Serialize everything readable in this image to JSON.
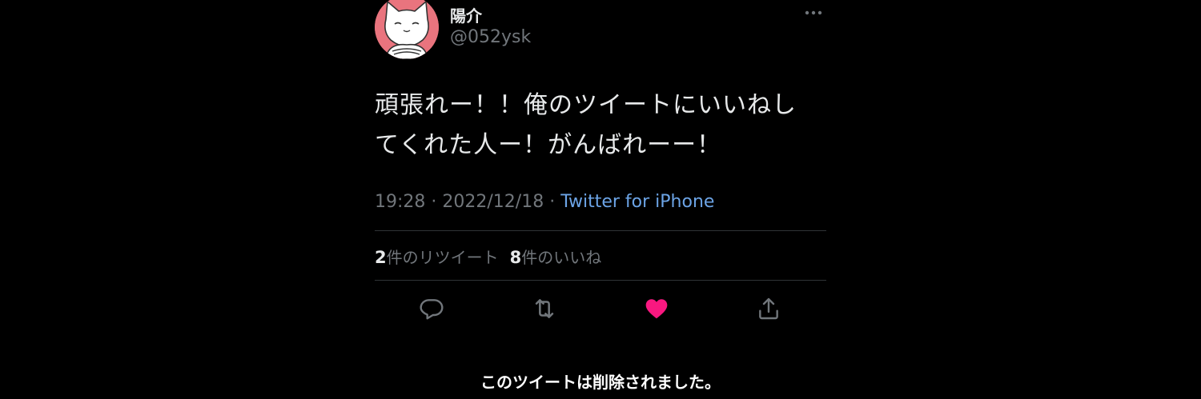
{
  "tweet": {
    "display_name": "陽介",
    "handle": "@052ysk",
    "text_line1": "頑張れー！！俺のツイートにいいねし",
    "text_line2": "てくれた人ー！がんばれーー！",
    "time": "19:28",
    "date": "2022/12/18",
    "separator": " · ",
    "source": "Twitter for iPhone",
    "retweets_count": "2",
    "retweets_label": "件のリツイート",
    "likes_count": "8",
    "likes_label": "件のいいね",
    "liked": true
  },
  "actions": [
    {
      "name": "reply",
      "icon": "speech-bubble-icon"
    },
    {
      "name": "retweet",
      "icon": "retweet-icon"
    },
    {
      "name": "like",
      "icon": "heart-icon"
    },
    {
      "name": "share",
      "icon": "share-icon"
    }
  ],
  "notice": {
    "deleted_text": "このツイートは削除されました。"
  },
  "colors": {
    "background": "#000000",
    "text_primary": "#e7e9ea",
    "text_secondary": "#71767b",
    "link": "#6ca4e6",
    "like_active": "#f91880",
    "divider": "#2f3336",
    "avatar_bg": "#e9747e"
  }
}
